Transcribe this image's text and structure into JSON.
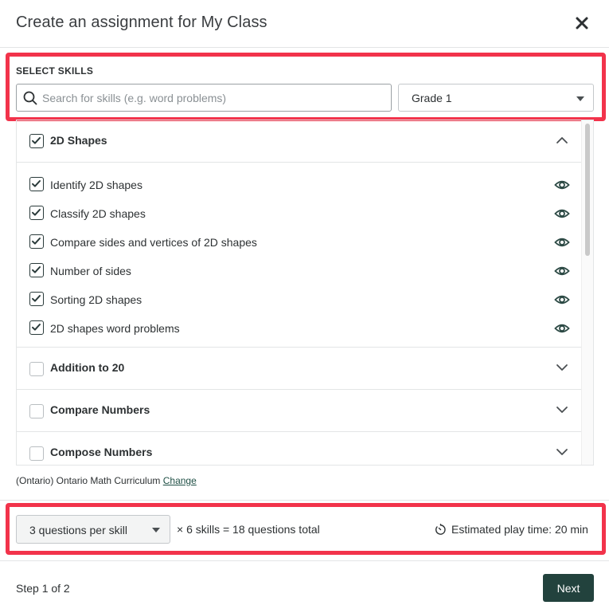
{
  "modal": {
    "title": "Create an assignment for My Class",
    "close_icon": "close-icon"
  },
  "filters": {
    "section_label": "SELECT SKILLS",
    "search": {
      "placeholder": "Search for skills (e.g. word problems)",
      "value": ""
    },
    "grade": {
      "selected": "Grade 1"
    }
  },
  "categories": [
    {
      "label": "2D Shapes",
      "checked": true,
      "expanded": true,
      "skills": [
        {
          "label": "Identify 2D shapes",
          "checked": true
        },
        {
          "label": "Classify 2D shapes",
          "checked": true
        },
        {
          "label": "Compare sides and vertices of 2D shapes",
          "checked": true
        },
        {
          "label": "Number of sides",
          "checked": true
        },
        {
          "label": "Sorting 2D shapes",
          "checked": true
        },
        {
          "label": "2D shapes word problems",
          "checked": true
        }
      ]
    },
    {
      "label": "Addition to 20",
      "checked": false,
      "expanded": false
    },
    {
      "label": "Compare Numbers",
      "checked": false,
      "expanded": false
    },
    {
      "label": "Compose Numbers",
      "checked": false,
      "expanded": false
    }
  ],
  "curriculum": {
    "text": "(Ontario) Ontario Math Curriculum",
    "change_label": "Change"
  },
  "summary": {
    "questions_per_skill": "3 questions per skill",
    "calculation": "× 6 skills = 18 questions total",
    "estimated_time": "Estimated play time: 20 min"
  },
  "footer": {
    "step": "Step 1 of 2",
    "next_label": "Next"
  },
  "colors": {
    "accent": "#22423d",
    "highlight": "#f2334b",
    "link": "#1f4f45"
  }
}
